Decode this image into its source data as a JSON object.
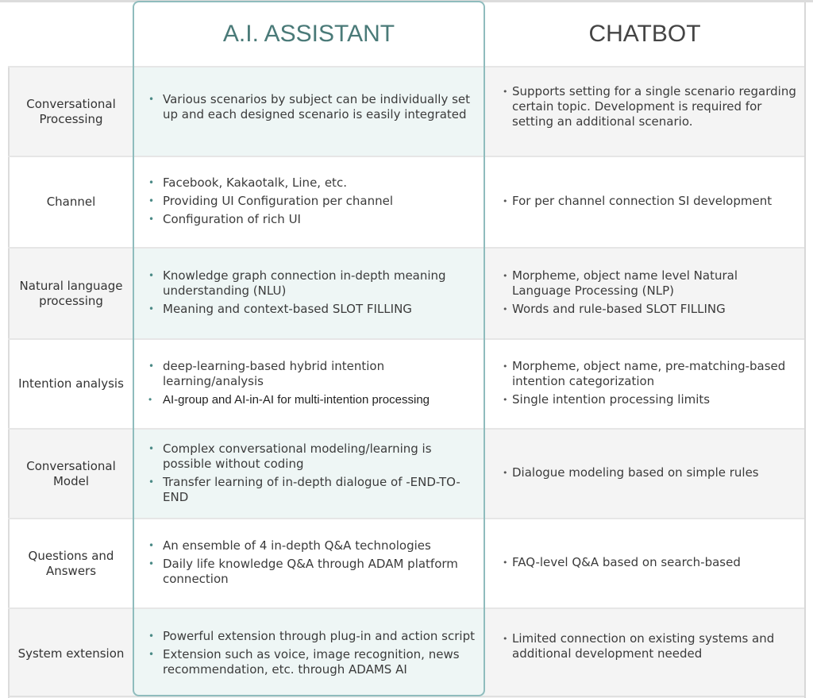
{
  "header": {
    "ai_title": "A.I. ASSISTANT",
    "chatbot_title": "CHATBOT"
  },
  "colors": {
    "ai_accent": "#4a7a78",
    "ai_border": "#8fbcbd",
    "ai_shade": "#eef6f5",
    "label_shade": "#f4f4f4"
  },
  "rows": [
    {
      "label": "Conversational Processing",
      "ai": [
        "Various scenarios by subject can be individually set up and each designed scenario is easily integrated"
      ],
      "chatbot": [
        "Supports setting for a single scenario regarding certain topic. Development is required for setting an additional scenario."
      ]
    },
    {
      "label": "Channel",
      "ai": [
        "Facebook, Kakaotalk, Line, etc.",
        "Providing UI Configuration per channel",
        "Configuration of rich UI"
      ],
      "chatbot": [
        "For per channel connection SI development"
      ]
    },
    {
      "label": "Natural language processing",
      "ai": [
        "Knowledge graph connection in-depth meaning understanding (NLU)",
        "Meaning and context-based SLOT FILLING"
      ],
      "chatbot": [
        "Morpheme, object name level Natural Language Processing (NLP)",
        "Words and rule-based SLOT FILLING"
      ]
    },
    {
      "label": "Intention analysis",
      "ai": [
        "deep-learning-based hybrid intention learning/analysis",
        "AI-group and AI-in-AI for multi-intention processing"
      ],
      "chatbot": [
        "Morpheme, object name, pre-matching-based intention categorization",
        "Single intention processing limits"
      ]
    },
    {
      "label": "Conversational Model",
      "ai": [
        "Complex conversational modeling/learning is possible without coding",
        "Transfer learning of in-depth dialogue of -END-TO-END"
      ],
      "chatbot": [
        "Dialogue modeling based on simple rules"
      ]
    },
    {
      "label": "Questions and Answers",
      "ai": [
        "An ensemble of 4 in-depth Q&A technologies",
        "Daily life knowledge Q&A through ADAM platform connection"
      ],
      "chatbot": [
        "FAQ-level Q&A based on search-based"
      ]
    },
    {
      "label": "System extension",
      "ai": [
        "Powerful extension through plug-in and action script",
        "Extension such as voice, image recognition, news recommendation, etc. through ADAMS AI"
      ],
      "chatbot": [
        "Limited connection on existing systems and additional development needed"
      ]
    }
  ]
}
